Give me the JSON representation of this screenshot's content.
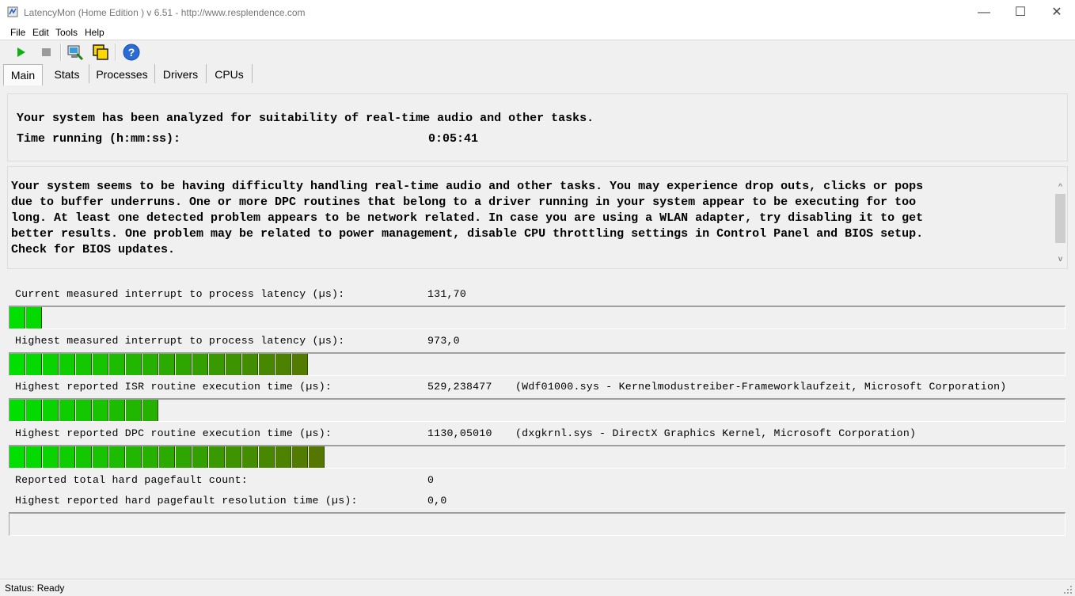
{
  "window": {
    "title": "LatencyMon  (Home Edition )  v 6.51 - http://www.resplendence.com",
    "minimize": "—",
    "maximize": "☐",
    "close": "✕"
  },
  "menu": [
    "File",
    "Edit",
    "Tools",
    "Help"
  ],
  "toolbar": {
    "start_icon": "play-icon",
    "stop_icon": "stop-icon",
    "system_icon": "system-tools-icon",
    "windows_icon": "windows-icon",
    "help_icon": "help-icon",
    "help_glyph": "?"
  },
  "tabs": [
    {
      "label": "Main",
      "active": true
    },
    {
      "label": "Stats",
      "active": false
    },
    {
      "label": "Processes",
      "active": false
    },
    {
      "label": "Drivers",
      "active": false
    },
    {
      "label": "CPUs",
      "active": false
    }
  ],
  "summary": {
    "analyzed": "Your system has been analyzed for suitability of real-time audio and other tasks.",
    "time_label": "Time running (h:mm:ss):",
    "time_value": "0:05:41"
  },
  "verdict": {
    "lines": [
      "Your system seems to be having difficulty handling real-time audio and other tasks. You may experience drop outs, clicks or pops",
      "due to buffer underruns. One or more DPC routines that belong to a driver running in your system appear to be executing for too",
      "long. At least one detected problem appears to be network related. In case you are using a WLAN adapter, try disabling it to get",
      "better results. One problem may be related to power management, disable CPU throttling settings in Control Panel and BIOS setup.",
      "Check for BIOS updates."
    ],
    "scroll_up": "^",
    "scroll_down": "v"
  },
  "metrics": [
    {
      "label": "Current measured interrupt to process latency (µs):",
      "value": "131,70",
      "source": "",
      "bar_segments": 2
    },
    {
      "label": "Highest measured interrupt to process latency (µs):",
      "value": "973,0",
      "source": "",
      "bar_segments": 18
    },
    {
      "label": "Highest reported ISR routine execution time (µs):",
      "value": "529,238477",
      "source": "(Wdf01000.sys - Kernelmodustreiber-Frameworklaufzeit, Microsoft Corporation)",
      "bar_segments": 9
    },
    {
      "label": "Highest reported DPC routine execution time (µs):",
      "value": "1130,05010",
      "source": "(dxgkrnl.sys - DirectX Graphics Kernel, Microsoft Corporation)",
      "bar_segments": 19
    },
    {
      "label": "Reported total hard pagefault count:",
      "value": "0",
      "source": ""
    },
    {
      "label": "Highest reported hard pagefault resolution time (µs):",
      "value": "0,0",
      "source": "",
      "bar_segments": 0
    }
  ],
  "status": {
    "text": "Status: Ready"
  },
  "colors": {
    "bar_green": "#00e000",
    "bar_olive": "#5a7000"
  }
}
